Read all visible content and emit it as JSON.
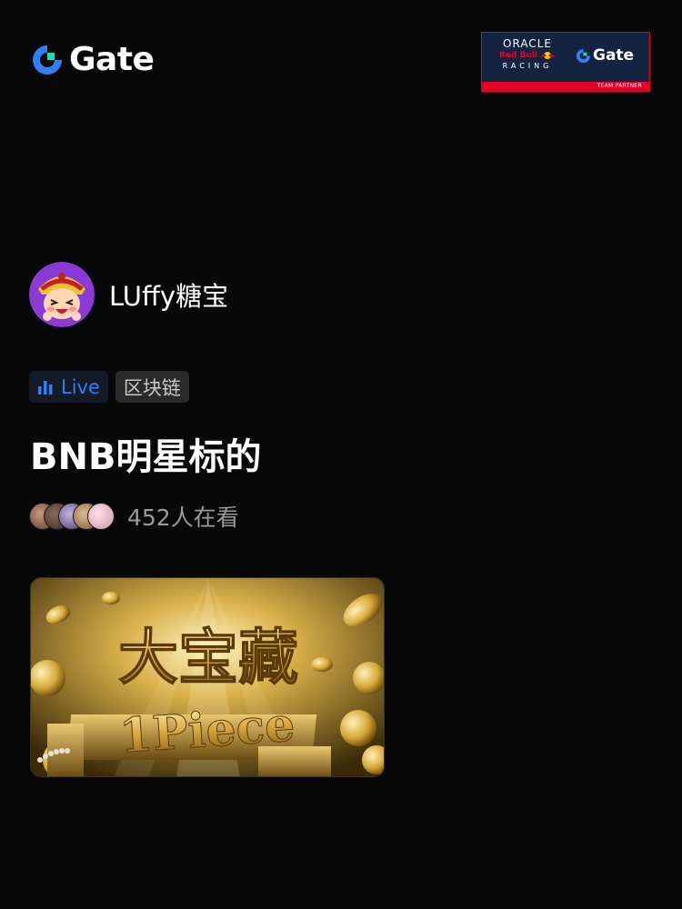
{
  "brand": {
    "name": "Gate",
    "logo_icon": "gate-logo-icon"
  },
  "partner_badge": {
    "line1": "ORACLE",
    "line2": "Red Bull",
    "line3": "RACING",
    "brand": "Gate",
    "strip": "TEAM PARTNER"
  },
  "streamer": {
    "name": "LUffy糖宝",
    "avatar": "cartoon-avatar"
  },
  "tags": {
    "live_label": "Live",
    "live_icon": "live-bars-icon",
    "category": "区块链"
  },
  "stream": {
    "title": "BNB明星标的",
    "viewer_count_text": "452人在看"
  },
  "cover": {
    "headline": "大宝藏",
    "subline": "1Piece"
  },
  "colors": {
    "background": "#080808",
    "accent_blue": "#2f80f5",
    "gate_green": "#17e6a1",
    "gold": "#d8b24a"
  }
}
